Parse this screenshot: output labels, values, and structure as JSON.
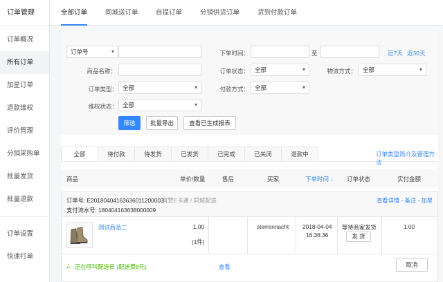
{
  "sidebar": {
    "title": "订单管理",
    "items": [
      {
        "label": "订单概况"
      },
      {
        "label": "所有订单"
      },
      {
        "label": "加星订单"
      },
      {
        "label": "退款维权"
      },
      {
        "label": "评价管理"
      },
      {
        "label": "分销采购单"
      },
      {
        "label": "批量发货"
      },
      {
        "label": "批量退款"
      }
    ],
    "items2": [
      {
        "label": "订单设置"
      },
      {
        "label": "快速打单"
      }
    ]
  },
  "topnav": {
    "tabs": [
      {
        "label": "全部订单"
      },
      {
        "label": "同城送订单"
      },
      {
        "label": "自提订单"
      },
      {
        "label": "分销供货订单"
      },
      {
        "label": "货到付款订单"
      }
    ]
  },
  "filter": {
    "order_no_select": "订单号",
    "order_time_label": "下单时间：",
    "time_to": "至",
    "last7": "近7天",
    "last30": "近30天",
    "product_name_label": "商品名称：",
    "order_status_label": "订单状态：",
    "order_status_value": "全部",
    "logistics_label": "物流方式：",
    "logistics_value": "全部",
    "order_type_label": "订单类型：",
    "order_type_value": "全部",
    "payment_label": "付款方式：",
    "payment_value": "全部",
    "rights_label": "维权状态：",
    "rights_value": "全部",
    "btn_filter": "筛选",
    "btn_export": "批量导出",
    "btn_reports": "查看已生成报表"
  },
  "status_tabs": [
    {
      "label": "全部"
    },
    {
      "label": "待付款"
    },
    {
      "label": "待发货"
    },
    {
      "label": "已发货"
    },
    {
      "label": "已完成"
    },
    {
      "label": "已关闭"
    },
    {
      "label": "退款中"
    }
  ],
  "order_type_help": "订单类型简介及管理方法",
  "table_headers": {
    "product": "商品",
    "price_qty": "单价/数量",
    "aftersale": "售后",
    "buyer": "买家",
    "order_time": "下单时间 ↓",
    "status": "订单状态",
    "amount": "实付金额"
  },
  "order": {
    "order_no": "订单号: E20180404163636011200003",
    "tags": "有赞E卡通 / 同城配送",
    "serial": "支付流水号: 180404163638000009",
    "actions": "查看详情 - 备注 - 加星",
    "product_name": "测试商品二",
    "price": "1.00",
    "qty": "(1件)",
    "buyer": "sterrennacht",
    "date": "2018-04-04",
    "time": "16:36:36",
    "status": "等待商家发货",
    "ship_btn": "发 货",
    "amount": "1.00",
    "delivery_status": "正在呼叫配送员 (配送费8元)",
    "view_link": "查看",
    "cancel_btn": "取消"
  }
}
